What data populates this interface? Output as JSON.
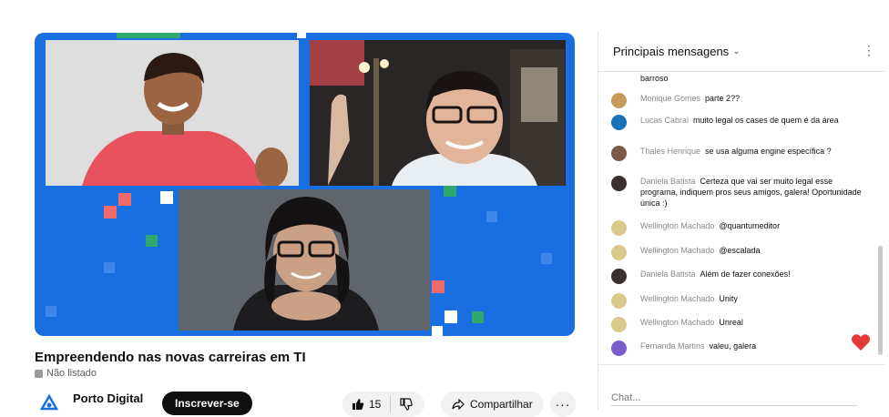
{
  "video": {
    "title": "Empreendendo nas novas carreiras em TI",
    "visibility": "Não listado",
    "channel": "Porto Digital",
    "subscribe_label": "Inscrever-se",
    "likes": "15",
    "share_label": "Compartilhar",
    "brand_blue": "#1a6fe0"
  },
  "chat": {
    "header_title": "Principais mensagens",
    "input_placeholder": "Chat...",
    "messages": [
      {
        "author": "",
        "text": "barroso",
        "avatar_color": "#ffffff"
      },
      {
        "author": "Monique Gomes",
        "text": "parte 2??",
        "avatar_color": "#c79a5b"
      },
      {
        "author": "Lucas Cabral",
        "text": "muito legal os cases de quem é da área",
        "avatar_color": "#1a73b8"
      },
      {
        "author": "Thales Henrique",
        "text": "se usa alguma engine específica ?",
        "avatar_color": "#7a5a48"
      },
      {
        "author": "Daniela Batista",
        "text": "Certeza que vai ser muito legal esse programa, indiquem pros seus amigos, galera! Oportunidade única :)",
        "avatar_color": "#3a3030"
      },
      {
        "author": "Wellington Machado",
        "text": "@quantumeditor",
        "avatar_color": "#d9c98a"
      },
      {
        "author": "Wellington Machado",
        "text": "@escalada",
        "avatar_color": "#d9c98a"
      },
      {
        "author": "Daniela Batista",
        "text": "Além de fazer conexões!",
        "avatar_color": "#3a3030"
      },
      {
        "author": "Wellington Machado",
        "text": "Unity",
        "avatar_color": "#d9c98a"
      },
      {
        "author": "Wellington Machado",
        "text": "Unreal",
        "avatar_color": "#d9c98a"
      },
      {
        "author": "Fernanda Martins",
        "text": "valeu, galera",
        "avatar_color": "#7b5cc9"
      }
    ]
  },
  "icons": {
    "like": "thumbs-up-icon",
    "dislike": "thumbs-down-icon",
    "share": "share-icon",
    "more": "more-horizontal-icon",
    "chat_more": "more-vertical-icon",
    "reaction": "heart-icon"
  }
}
